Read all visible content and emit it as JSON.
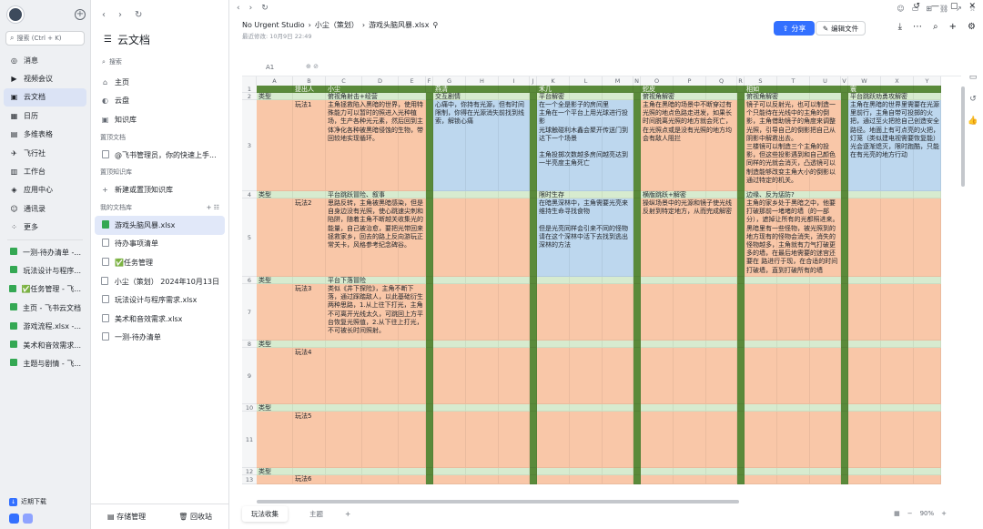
{
  "nav": {
    "search_placeholder": "搜索 (Ctrl + K)",
    "items": [
      {
        "icon": "message-icon",
        "label": "消息"
      },
      {
        "icon": "video-icon",
        "label": "视频会议"
      },
      {
        "icon": "cloud-doc-icon",
        "label": "云文档",
        "active": true
      },
      {
        "icon": "calendar-icon",
        "label": "日历"
      },
      {
        "icon": "table-icon",
        "label": "多维表格"
      },
      {
        "icon": "flight-icon",
        "label": "飞行社"
      },
      {
        "icon": "workbench-icon",
        "label": "工作台"
      },
      {
        "icon": "app-center-icon",
        "label": "应用中心"
      },
      {
        "icon": "contacts-icon",
        "label": "通讯录"
      },
      {
        "icon": "more-icon",
        "label": "更多"
      }
    ],
    "pinned": [
      {
        "label": "一测-待办清单 -..."
      },
      {
        "label": "玩法设计与程序..."
      },
      {
        "label": "✅任务管理 - 飞..."
      },
      {
        "label": "主页 - 飞书云文档"
      },
      {
        "label": "游戏流程.xlsx -..."
      },
      {
        "label": "美术和音效需求..."
      },
      {
        "label": "主题与剧情 - 飞..."
      }
    ],
    "promo": "近期下载"
  },
  "sidebar": {
    "title": "云文档",
    "search": "搜索",
    "items": [
      {
        "label": "主页"
      },
      {
        "label": "云盘"
      },
      {
        "label": "知识库"
      }
    ],
    "pinned_docs_title": "置顶文档",
    "pinned_doc": "@飞书管理员，你的快速上手...",
    "pinned_wiki_title": "置顶知识库",
    "new_wiki": "新建或置顶知识库",
    "my_library": "我的文档库",
    "files": [
      {
        "label": "游戏头脑风暴.xlsx",
        "type": "xlsx",
        "selected": true
      },
      {
        "label": "待办事项清单",
        "type": "doc"
      },
      {
        "label": "✅任务管理",
        "type": "doc"
      },
      {
        "label": "小尘（策划） 2024年10月13日",
        "type": "doc"
      },
      {
        "label": "玩法设计与程序需求.xlsx",
        "type": "doc"
      },
      {
        "label": "美术和音效需求.xlsx",
        "type": "doc"
      },
      {
        "label": "一测-待办清单",
        "type": "doc"
      }
    ],
    "bottom": {
      "storage": "存储管理",
      "trash": "回收站"
    }
  },
  "doc": {
    "breadcrumb": [
      "No Urgent Studio",
      "›",
      "小尘（策划）",
      "›",
      "游戏头脑风暴.xlsx"
    ],
    "modified": "最近修改: 10月9日 22:49",
    "share": "分享",
    "edit": "编辑文件",
    "cellref": "A1"
  },
  "sheet": {
    "cols": [
      "A",
      "B",
      "C",
      "D",
      "E",
      "F",
      "G",
      "H",
      "I",
      "J",
      "K",
      "L",
      "M",
      "N",
      "O",
      "P",
      "Q",
      "R",
      "S",
      "T",
      "U",
      "V",
      "W",
      "X",
      "Y"
    ],
    "header_row": {
      "B": "提出人",
      "C": "小尘",
      "G": "燕清",
      "K": "禾几",
      "O": "蛇皮",
      "S": "相如",
      "W": "寰"
    },
    "cells": [
      {
        "row": 2,
        "col": "A",
        "text": "类型"
      },
      {
        "row": 2,
        "col": "C",
        "text": "俯视角射击+经营"
      },
      {
        "row": 2,
        "col": "G",
        "text": "交互剧情"
      },
      {
        "row": 2,
        "col": "K",
        "text": "平台解密"
      },
      {
        "row": 2,
        "col": "O",
        "text": "俯视角解密"
      },
      {
        "row": 2,
        "col": "S",
        "text": "俯视角解密"
      },
      {
        "row": 2,
        "col": "W",
        "text": "平台跳跃劝勇攻解密"
      },
      {
        "row": 3,
        "col": "B",
        "text": "玩法1"
      },
      {
        "row": 3,
        "col": "C",
        "text": "主角拯救陷入黑暗的世界，使用特殊能力可以暂时的照进入光种植场，生产各种光元素，然后回到主体净化各种被黑暗侵蚀的生物，带回较地实现循环。"
      },
      {
        "row": 3,
        "col": "G",
        "text": "心痛中，你持有光源，但有时间限制，你得在光源消失前找到线索，解锁心痛"
      },
      {
        "row": 3,
        "col": "K",
        "text": "在一个全是影子的房间里\n主角在一个平台上用光球进行投影\n光球触碰利木鑫会聚开传送门到达下一个场景\n\n主角投掷次数越多房间越亮达到一半亮度主角死亡"
      },
      {
        "row": 3,
        "col": "O",
        "text": "主角在黑暗的场景中不断穿过有光照的地点色路走进发，如果长时间脱离光照的地方就会死亡，在光照点或是没有光照的地方均会有敌人阻拦"
      },
      {
        "row": 3,
        "col": "S",
        "text": "镜子可以反射光，也可以制造一个只能待在光线中的主角的倒影，主角借助镜子的角度来调整光照，引导自己的倒影把自己从阴影中解救出去。\n三楼镜可以制造三个主角的投影，但这些投影遇到和自己颜色同样的光就会消灭，凸透镜可以制造能够改变主角大小的倒影以通过特定的机关。"
      },
      {
        "row": 3,
        "col": "W",
        "text": "主角在黑暗的世界里需要在光源里前行，主角自带可投掷的火把，通过至火把抢自己创造安全路径。地面上有可点亮的火把，灯笼（类似建电视需要恢复能）光会逐渐熄灭，限时跑酷，只能在有光亮的地方行动"
      },
      {
        "row": 4,
        "col": "A",
        "text": "类型"
      },
      {
        "row": 4,
        "col": "C",
        "text": "平台跳跃冒险、叙事"
      },
      {
        "row": 4,
        "col": "K",
        "text": "限时生存"
      },
      {
        "row": 4,
        "col": "O",
        "text": "横版跳跃+解密"
      },
      {
        "row": 4,
        "col": "S",
        "text": "边缘、反为惩防?"
      },
      {
        "row": 5,
        "col": "B",
        "text": "玩法2"
      },
      {
        "row": 5,
        "col": "C",
        "text": "思路反转，主角被黑暗感染，但是自身边没有光照，使心跳速尖刺和陷阱，随着主角不断越关收集光的能量，自己被治愈，要把光带回来拯救家乡，回去的路上反向游玩正常关卡，风格参考纪念碑谷。"
      },
      {
        "row": 5,
        "col": "K",
        "text": "在暗黑深林中，主角需要光亮来维持生命寻找食物\n\n但是光亮同样会引来不同的怪物 请在这个深林中活下去找到逃出深林的方法"
      },
      {
        "row": 5,
        "col": "O",
        "text": "操纵场景中的光源和镜子使光线反射到特定地方，从而完成解密"
      },
      {
        "row": 5,
        "col": "S",
        "text": "主角的家乡处于黑暗之中，他要打破那前一堵堵的墙（的一部分），遮掉让所有的光都照进来。黑暗里有一些怪物，被光照到的地方现有的怪物会消失，消失的怪物越多，主角就有力气打破更多的墙，在最后地需要的迷宫还要在 路进行于现，在合适的时间打破墙，直到打破所有的墙"
      },
      {
        "row": 6,
        "col": "A",
        "text": "类型"
      },
      {
        "row": 6,
        "col": "C",
        "text": "平台下落冒险"
      },
      {
        "row": 7,
        "col": "B",
        "text": "玩法3"
      },
      {
        "row": 7,
        "col": "C",
        "text": "类似《井下探险》，主角不断下落，通过踩踏敌人，以此基础衍生两种思路，1.从上往下打光，主角不可离开光线太久，可跳回上方平台恢复光照值，2.从下往上打光，不可被长时间照射。"
      },
      {
        "row": 8,
        "col": "A",
        "text": "类型"
      },
      {
        "row": 9,
        "col": "B",
        "text": "玩法4"
      },
      {
        "row": 10,
        "col": "A",
        "text": "类型"
      },
      {
        "row": 11,
        "col": "B",
        "text": "玩法5"
      },
      {
        "row": 12,
        "col": "A",
        "text": "类型"
      },
      {
        "row": 13,
        "col": "B",
        "text": "玩法6"
      }
    ],
    "rows_tall": {
      "1": 8,
      "2": 8,
      "3": 100,
      "4": 8,
      "5": 86,
      "6": 8,
      "7": 62,
      "8": 8,
      "9": 62,
      "10": 8,
      "11": 62,
      "12": 8,
      "13": 10
    }
  },
  "tabs": {
    "active": "玩法收集",
    "other": "主题",
    "add": "+"
  },
  "zoom": "90%",
  "colors": {
    "green": "#5a8a3a",
    "type_row": "#d7ebcf",
    "orange": "#f9c7a8",
    "blue": "#bdd7ee",
    "yellow": "#fff2cc",
    "accent": "#3370ff"
  }
}
